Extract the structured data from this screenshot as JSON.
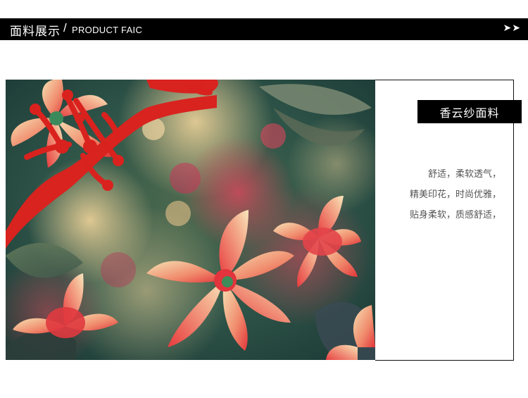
{
  "header": {
    "title_zh": "面料展示",
    "separator": "/",
    "title_en": "PRODUCT FAIC",
    "arrows": "➤➤"
  },
  "photo": {
    "alt": "fabric detail photo with floral print and red frog buttons",
    "colors": {
      "petal_red": "#e8393a",
      "petal_light": "#f2d7a9",
      "leaf_green": "#2d5a48",
      "deep_teal": "#24473f",
      "button_red": "#d9221e"
    }
  },
  "panel": {
    "title": "香云纱面料",
    "lines": [
      "舒适，柔软透气，",
      "精美印花，时尚优雅，",
      "贴身柔软，质感舒适，"
    ]
  }
}
